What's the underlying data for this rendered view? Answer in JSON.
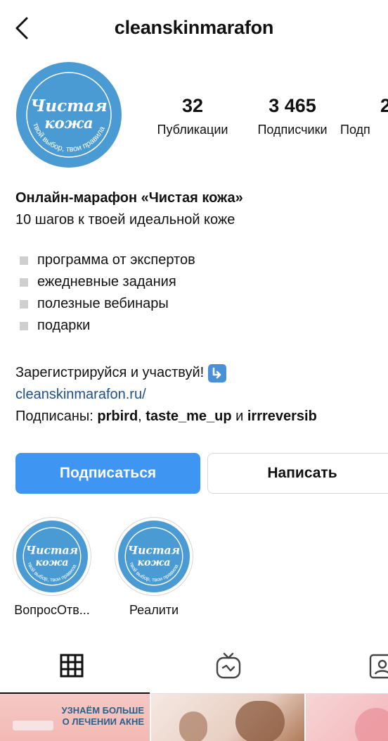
{
  "header": {
    "username": "cleanskinmarafon"
  },
  "avatar": {
    "line1": "Чистая",
    "line2": "кожа",
    "arc": "твой выбор, твои правила"
  },
  "stats": [
    {
      "value": "32",
      "label": "Публикации"
    },
    {
      "value": "3 465",
      "label": "Подписчики"
    },
    {
      "value": "2",
      "label": "Подп"
    }
  ],
  "bio": {
    "title": "Онлайн-марафон «Чистая кожа»",
    "subtitle": "10 шагов к твоей идеальной коже",
    "bullets": [
      "программа от экспертов",
      "ежедневные задания",
      "полезные вебинары",
      "подарки"
    ],
    "cta": "Зарегистрируйся и участвуй!",
    "link": "cleanskinmarafon.ru/",
    "followed_prefix": "Подписаны: ",
    "followed_1": "prbird",
    "sep": ", ",
    "followed_2": "taste_me_up",
    "and": " и ",
    "followed_3": "irrreversib"
  },
  "buttons": {
    "follow": "Подписаться",
    "message": "Написать"
  },
  "highlights": [
    {
      "label": "ВопросОтв..."
    },
    {
      "label": "Реалити"
    }
  ],
  "tabs": {
    "grid_icon": "grid-icon",
    "igtv_icon": "igtv-icon",
    "tagged_icon": "tagged-icon"
  },
  "thumbs": {
    "t1_line1": "УЗНАЁМ БОЛЬШЕ",
    "t1_line2": "О ЛЕЧЕНИИ АКНЕ"
  },
  "colors": {
    "accent": "#3f95f2",
    "brand": "#4a9bd3",
    "link": "#1e4f8f"
  }
}
